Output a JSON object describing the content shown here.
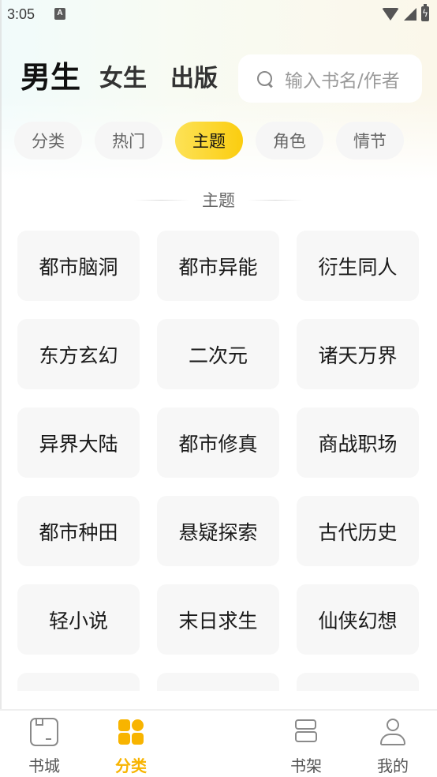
{
  "status_bar": {
    "time": "3:05",
    "notification_icon": "A",
    "icons": [
      "wifi-icon",
      "signal-icon",
      "battery-charging-icon"
    ]
  },
  "header": {
    "gender_tabs": [
      {
        "label": "男生",
        "active": true
      },
      {
        "label": "女生",
        "active": false
      },
      {
        "label": "出版",
        "active": false
      }
    ],
    "search": {
      "placeholder": "输入书名/作者",
      "icon": "search-icon"
    }
  },
  "filter_chips": [
    {
      "label": "分类",
      "active": false
    },
    {
      "label": "热门",
      "active": false
    },
    {
      "label": "主题",
      "active": true
    },
    {
      "label": "角色",
      "active": false
    },
    {
      "label": "情节",
      "active": false
    }
  ],
  "section": {
    "title": "主题"
  },
  "topics": [
    "都市脑洞",
    "都市异能",
    "衍生同人",
    "东方玄幻",
    "二次元",
    "诸天万界",
    "异界大陆",
    "都市修真",
    "商战职场",
    "都市种田",
    "悬疑探索",
    "古代历史",
    "轻小说",
    "末日求生",
    "仙侠幻想",
    "",
    "",
    ""
  ],
  "bottom_nav": [
    {
      "label": "书城",
      "icon": "bookstore-icon",
      "active": false
    },
    {
      "label": "分类",
      "icon": "category-icon",
      "active": true
    },
    {
      "label": "书架",
      "icon": "bookshelf-icon",
      "active": false
    },
    {
      "label": "我的",
      "icon": "profile-icon",
      "active": false
    }
  ],
  "colors": {
    "accent": "#f8b400",
    "chip_active_start": "#fde257",
    "chip_active_end": "#fbcd0f",
    "tile_bg": "#f7f7f7",
    "chip_bg": "#f6f6f6"
  }
}
